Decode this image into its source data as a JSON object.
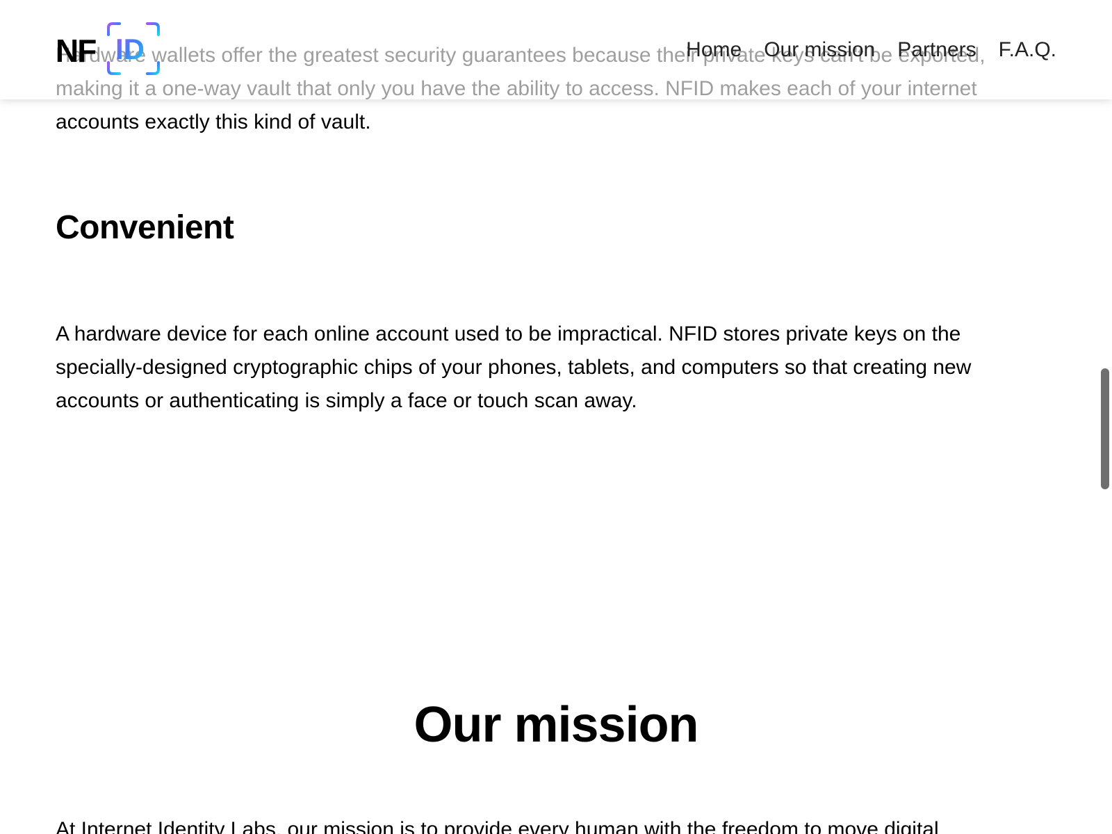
{
  "header": {
    "logo": {
      "text_nf": "NF",
      "text_id": "ID"
    },
    "nav": [
      {
        "label": "Home"
      },
      {
        "label": "Our mission"
      },
      {
        "label": "Partners"
      },
      {
        "label": "F.A.Q."
      }
    ]
  },
  "main": {
    "intro_paragraph": "Hardware wallets offer the greatest security guarantees because their private keys can't be exported, making it a one-way vault that only you have the ability to access. NFID makes each of your internet accounts exactly this kind of vault.",
    "convenient": {
      "heading": "Convenient",
      "paragraph": "A hardware device for each online account used to be impractical. NFID stores private keys on the specially-designed cryptographic chips of your phones, tablets, and computers so that creating new accounts or authenticating is simply a face or touch scan away."
    },
    "mission": {
      "heading": "Our mission",
      "paragraph": "At Internet Identity Labs, our mission is to provide every human with the freedom to move digital"
    }
  },
  "colors": {
    "logo_gradient_start": "#a855f7",
    "logo_gradient_mid": "#3b82f6",
    "logo_gradient_end": "#22d3ee",
    "text": "#000000",
    "scrollbar": "#6f6f6f"
  }
}
